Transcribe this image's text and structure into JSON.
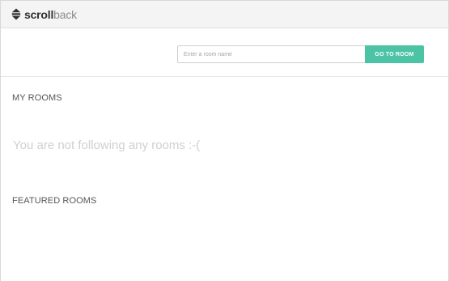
{
  "header": {
    "logo_bold": "scroll",
    "logo_light": "back",
    "logo_icon": "scrollback-logo-icon"
  },
  "search": {
    "placeholder": "Enter a room name",
    "value": "",
    "button_label": "GO TO ROOM"
  },
  "my_rooms": {
    "title": "MY ROOMS",
    "empty_message": "You are not following any rooms :-("
  },
  "featured_rooms": {
    "title": "FEATURED ROOMS"
  },
  "colors": {
    "accent": "#4cc3a4",
    "header_bg": "#f4f4f4",
    "muted_text": "#cfcfcf"
  }
}
